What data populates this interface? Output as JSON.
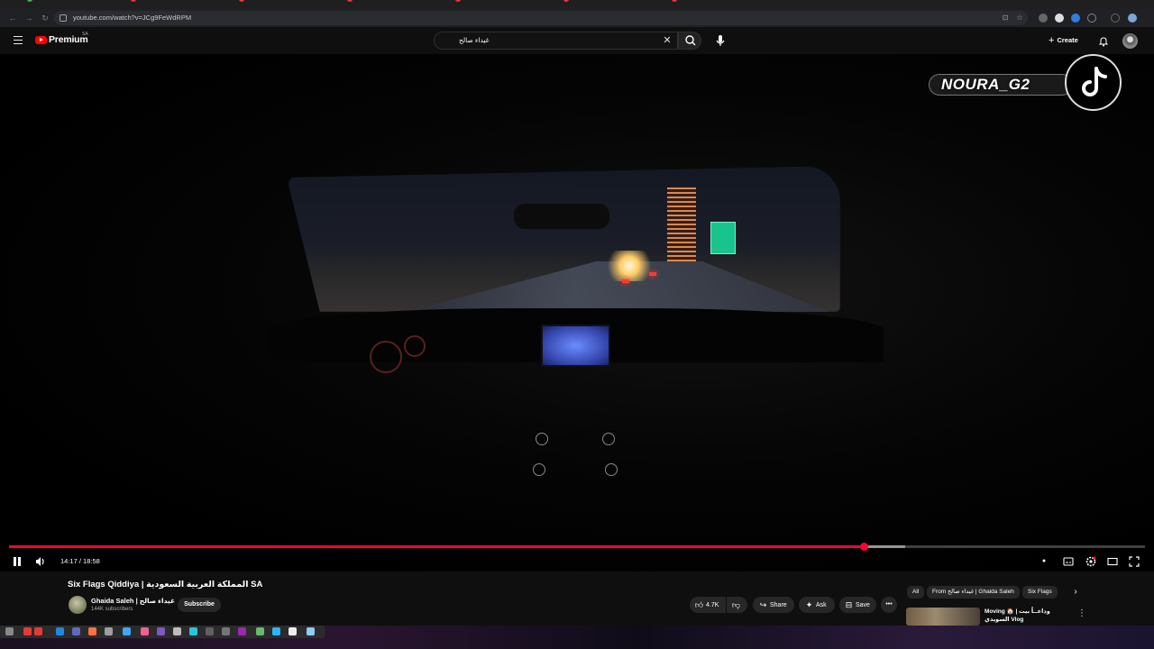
{
  "browser": {
    "url": "youtube.com/watch?v=JCg9FeWdRPM"
  },
  "masthead": {
    "logo_text": "Premium",
    "region": "SA",
    "search_query": "غيداء صالح",
    "create_label": "Create"
  },
  "player": {
    "watermark": "NOURA_G2",
    "current_time": "14:17",
    "separator": " / ",
    "duration": "18:58",
    "time_display": "14:17 / 18:58",
    "played_fraction": 0.7527,
    "buffered_fraction": 0.7887
  },
  "video": {
    "title": "Six Flags Qiddiya | المملكة العربية السعودية SA",
    "channel_name": "Ghaida Saleh | غيداء صالح",
    "subscribers": "144K subscribers",
    "subscribe_label": "Subscribe",
    "likes": "4.7K",
    "share_label": "Share",
    "ask_label": "Ask",
    "save_label": "Save"
  },
  "recommendations": {
    "chips": [
      "All",
      "From غيداء صالح | Ghaida Saleh",
      "Six Flags"
    ],
    "first_title": "Moving 🏠 | وداعــاً بيت السويدي Vlog"
  },
  "colors": {
    "accent": "#ff0033",
    "background": "#0f0f0f",
    "chip_bg": "#272727"
  }
}
